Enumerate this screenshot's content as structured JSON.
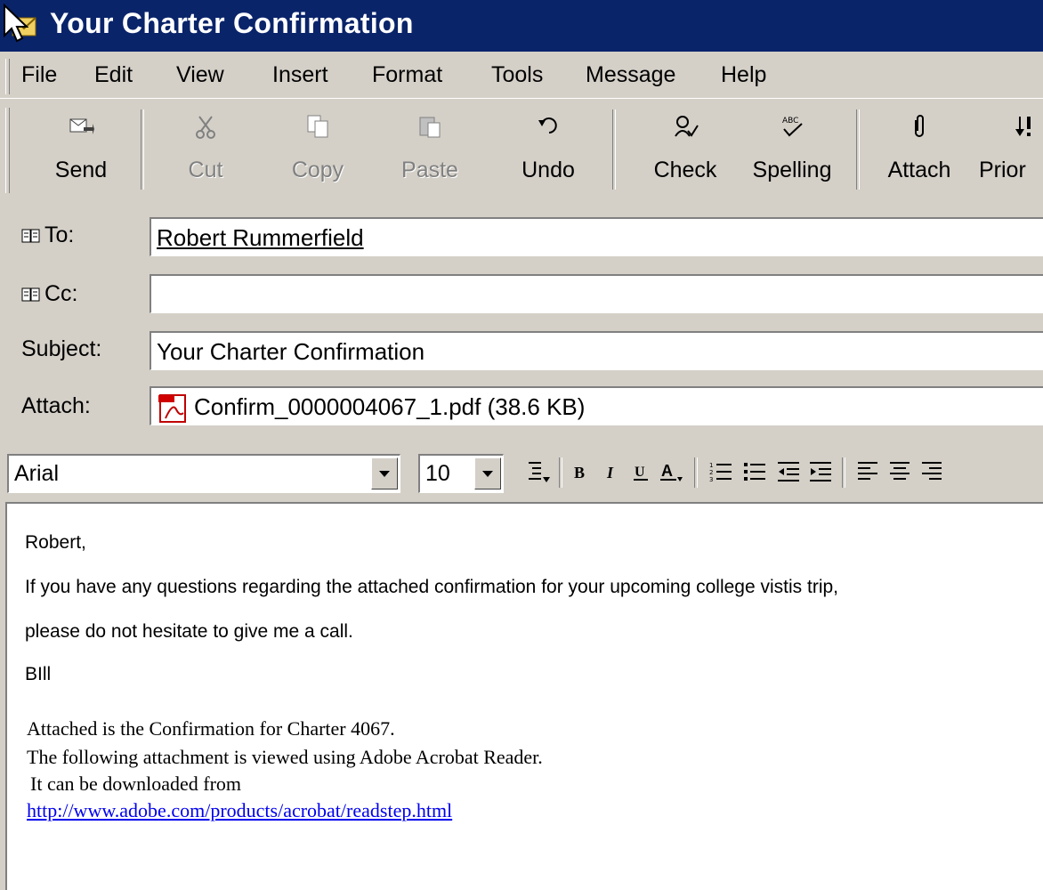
{
  "window": {
    "title": "Your Charter Confirmation"
  },
  "menu": {
    "items": [
      "File",
      "Edit",
      "View",
      "Insert",
      "Format",
      "Tools",
      "Message",
      "Help"
    ]
  },
  "toolbar": {
    "send": "Send",
    "cut": "Cut",
    "copy": "Copy",
    "paste": "Paste",
    "undo": "Undo",
    "check": "Check",
    "spelling": "Spelling",
    "attach": "Attach",
    "priority": "Prior"
  },
  "header": {
    "to_label": "To:",
    "to_value": "Robert Rummerfield",
    "cc_label": "Cc:",
    "cc_value": "",
    "subject_label": "Subject:",
    "subject_value": "Your Charter Confirmation",
    "attach_label": "Attach:",
    "attach_value": "Confirm_0000004067_1.pdf (38.6 KB)"
  },
  "format": {
    "font": "Arial",
    "size": "10"
  },
  "message": {
    "greeting": "Robert,",
    "line1": "If you have any questions regarding the attached confirmation for your upcoming college vistis trip,",
    "line2": "please do not hesitate to give me a call.",
    "signoff": "BIll",
    "notice1": "Attached is the Confirmation for Charter 4067.",
    "notice2": "The following attachment is viewed using Adobe Acrobat Reader.",
    "notice3": "It can be downloaded from",
    "link": "http://www.adobe.com/products/acrobat/readstep.html"
  }
}
